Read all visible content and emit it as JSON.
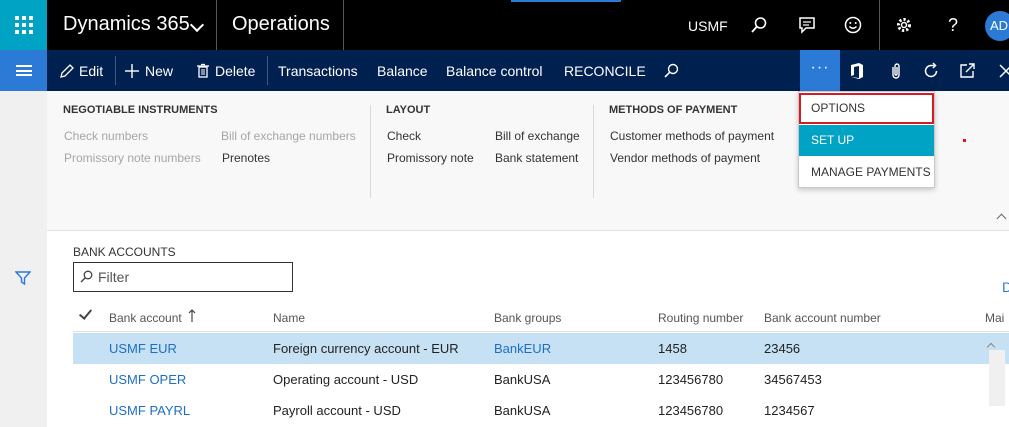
{
  "topbar": {
    "app_name": "Dynamics 365",
    "module": "Operations",
    "company": "USMF",
    "user_initials": "AD",
    "icons": [
      "waffle-icon",
      "chevron-down-icon",
      "search-icon",
      "message-icon",
      "smiley-icon",
      "gear-icon",
      "help-icon"
    ]
  },
  "actionbar": {
    "edit": "Edit",
    "new": "New",
    "delete": "Delete",
    "transactions": "Transactions",
    "balance": "Balance",
    "balance_control": "Balance control",
    "reconcile": "RECONCILE",
    "more": "···",
    "icons": [
      "hamburger-icon",
      "pencil-icon",
      "plus-icon",
      "trash-icon",
      "search-icon",
      "office-icon",
      "attachment-icon",
      "refresh-icon",
      "popout-icon",
      "close-icon"
    ]
  },
  "ribbon": {
    "groups": [
      {
        "title": "NEGOTIABLE INSTRUMENTS",
        "items": [
          {
            "label": "Check numbers",
            "enabled": false
          },
          {
            "label": "Promissory note numbers",
            "enabled": false
          },
          {
            "label": "Bill of exchange numbers",
            "enabled": false
          },
          {
            "label": "Prenotes",
            "enabled": true
          }
        ]
      },
      {
        "title": "LAYOUT",
        "items": [
          {
            "label": "Check",
            "enabled": true
          },
          {
            "label": "Promissory note",
            "enabled": true
          },
          {
            "label": "Bill of exchange",
            "enabled": true
          },
          {
            "label": "Bank statement",
            "enabled": true
          }
        ]
      },
      {
        "title": "METHODS OF PAYMENT",
        "items": [
          {
            "label": "Customer methods of payment",
            "enabled": true
          },
          {
            "label": "Vendor methods of payment",
            "enabled": true
          }
        ]
      }
    ]
  },
  "dropdown": {
    "items": [
      {
        "label": "OPTIONS",
        "state": "highlighted-box"
      },
      {
        "label": "SET UP",
        "state": "selected"
      },
      {
        "label": "MANAGE PAYMENTS",
        "state": "normal"
      }
    ]
  },
  "list": {
    "title": "BANK ACCOUNTS",
    "filter_placeholder": "Filter",
    "overflow_link": "D",
    "columns": [
      "Bank account",
      "Name",
      "Bank groups",
      "Routing number",
      "Bank account number",
      "Mai"
    ],
    "sort_column": "Bank account",
    "rows": [
      {
        "bank_account": "USMF EUR",
        "name": "Foreign currency account - EUR",
        "bank_group": "BankEUR",
        "routing_number": "1458",
        "bank_account_number": "23456",
        "selected": true
      },
      {
        "bank_account": "USMF OPER",
        "name": "Operating account - USD",
        "bank_group": "BankUSA",
        "routing_number": "123456780",
        "bank_account_number": "34567453",
        "selected": false
      },
      {
        "bank_account": "USMF PAYRL",
        "name": "Payroll account - USD",
        "bank_group": "BankUSA",
        "routing_number": "123456780",
        "bank_account_number": "1234567",
        "selected": false
      }
    ]
  },
  "colors": {
    "top_bar": "#000000",
    "action_bar": "#002050",
    "accent_teal": "#00a3c4",
    "accent_blue": "#2b7bd6",
    "selected_row": "#c6e1f4",
    "options_outline": "#d71b25"
  }
}
